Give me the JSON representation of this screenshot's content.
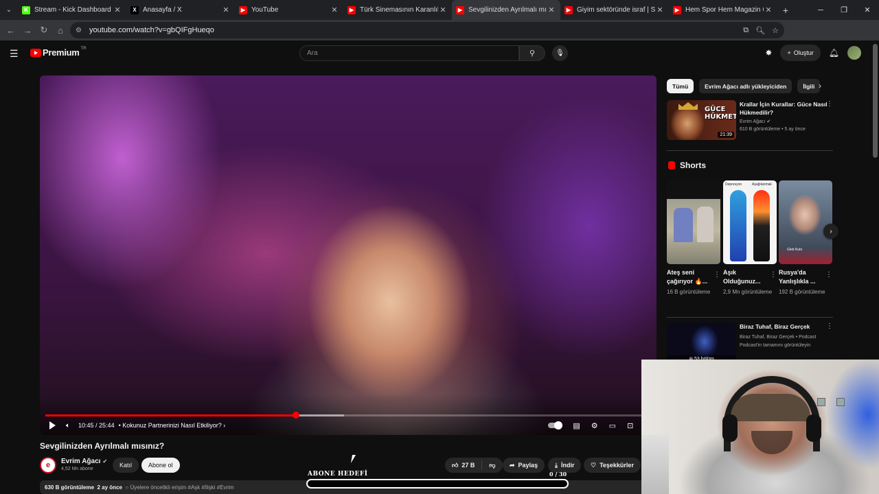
{
  "browser": {
    "tabs": [
      {
        "label": "Stream - Kick Dashboard",
        "fav_color": "#53fc18",
        "fav_glyph": "K"
      },
      {
        "label": "Anasayfa / X",
        "fav_color": "#000000",
        "fav_glyph": "X"
      },
      {
        "label": "YouTube",
        "fav_color": "#ff0000",
        "fav_glyph": "▶"
      },
      {
        "label": "Türk Sinemasının Karanlık Yüzü",
        "fav_color": "#ff0000",
        "fav_glyph": "▶"
      },
      {
        "label": "Sevgilinizden Ayrılmalı mısınız?",
        "fav_color": "#ff0000",
        "fav_glyph": "▶"
      },
      {
        "label": "Giyim sektöründe israf | Satılam",
        "fav_color": "#ff0000",
        "fav_glyph": "▶"
      },
      {
        "label": "Hem Spor Hem Magazin 😄 | A",
        "fav_color": "#ff0000",
        "fav_glyph": "▶"
      }
    ],
    "active_tab": 4,
    "url": "youtube.com/watch?v=gbQIFgHueqo"
  },
  "youtube": {
    "logo_text": "Premium",
    "country": "TR",
    "search_placeholder": "Ara",
    "create_label": "Oluştur"
  },
  "player": {
    "time_current": "10:45",
    "time_total": "25:44",
    "chapter": "• Kokunuz Partnerinizi Nasıl Etkiliyor?",
    "played_fraction": 0.42,
    "buffered_fraction": 0.5
  },
  "video": {
    "title": "Sevgilinizden Ayrılmalı mısınız?",
    "channel_name": "Evrim Ağacı",
    "channel_initial": "e",
    "subscribers": "4,52 Mn abone",
    "join_label": "Katıl",
    "subscribe_label": "Abone ol",
    "likes": "27 B",
    "share_label": "Paylaş",
    "download_label": "İndir",
    "thanks_label": "Teşekkürler",
    "views": "630 B görüntüleme",
    "age": "2 ay önce",
    "desc_rest": "Üyelere öncelikli erişim",
    "hashtags": "#Aşk #İlişki #Evrim"
  },
  "overlay": {
    "goal_label": "ABONE HEDEFİ",
    "goal_count": "0 / 30",
    "goal_fraction": 0
  },
  "sidebar": {
    "chips": [
      "Tümü",
      "Evrim Ağacı adlı yükleyiciden",
      "İlgili"
    ],
    "rec1": {
      "title": "Krallar İçin Kurallar: Güce Nasıl Hükmedilir?",
      "channel": "Evrim Ağacı",
      "meta": "610 B görüntüleme • 5 ay önce",
      "duration": "21:39",
      "thumb_text": "GÜCE HÜKMET!"
    },
    "shorts_title": "Shorts",
    "shorts": [
      {
        "title": "Ateş seni çağırıyor 🔥...",
        "views": "16 B görüntüleme"
      },
      {
        "title": "Aşık Olduğunuz...",
        "views": "2,9 Mn görüntüleme",
        "thumb_l": "Depresyon",
        "thumb_r": "Aşağılanmak"
      },
      {
        "title": "Rusya'da Yanlışlıkla ...",
        "views": "192 B görüntüleme",
        "thumb_caption": "Gleb Kuto"
      }
    ],
    "rec2": {
      "title": "Biraz Tuhaf, Biraz Gerçek",
      "channel": "Biraz Tuhaf, Biraz Gerçek • Podcast",
      "meta": "Podcast'in tamamını görüntüleyin",
      "episodes": "53 bölüm"
    }
  }
}
